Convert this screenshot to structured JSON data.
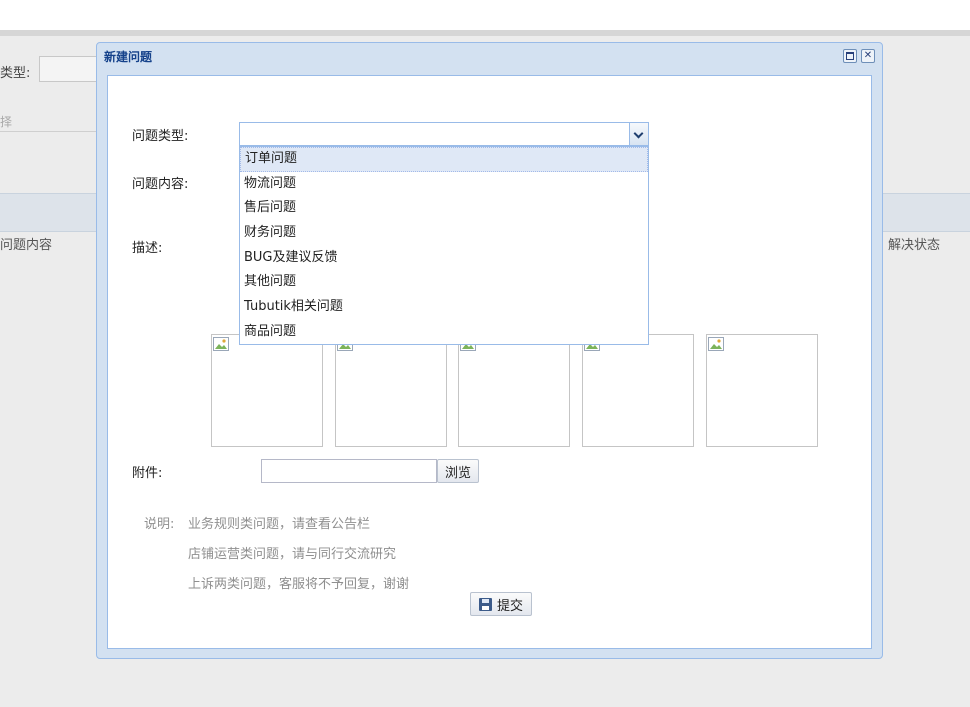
{
  "background": {
    "type_label_fragment": "类型:",
    "hint_fragment": "择",
    "column_left": "问题内容",
    "column_right": "解决状态"
  },
  "window": {
    "title": "新建问题",
    "tools": {
      "maximize": "maximize-icon",
      "close": "close-icon"
    }
  },
  "form": {
    "type_label": "问题类型:",
    "type_value": "",
    "content_label": "问题内容:",
    "desc_label": "描述:",
    "attach_label": "附件:",
    "attach_value": "",
    "browse_label": "浏览",
    "submit_label": "提交"
  },
  "dropdown": {
    "selected_index": 0,
    "options": [
      "订单问题",
      "物流问题",
      "售后问题",
      "财务问题",
      "BUG及建议反馈",
      "其他问题",
      "Tubutik相关问题",
      "商品问题"
    ]
  },
  "notes": {
    "prefix": "说明:",
    "lines": [
      "业务规则类问题，请查看公告栏",
      "店铺运营类问题，请与同行交流研究",
      "上诉两类问题，客服将不予回复，谢谢"
    ]
  },
  "images": {
    "count": 5,
    "icon": "broken-image-icon"
  },
  "colors": {
    "title": "#15428b",
    "window_frame": "#d3e1f1",
    "border": "#99bbe8",
    "selected": "#dfe8f6",
    "note": "#8f8f8f"
  }
}
